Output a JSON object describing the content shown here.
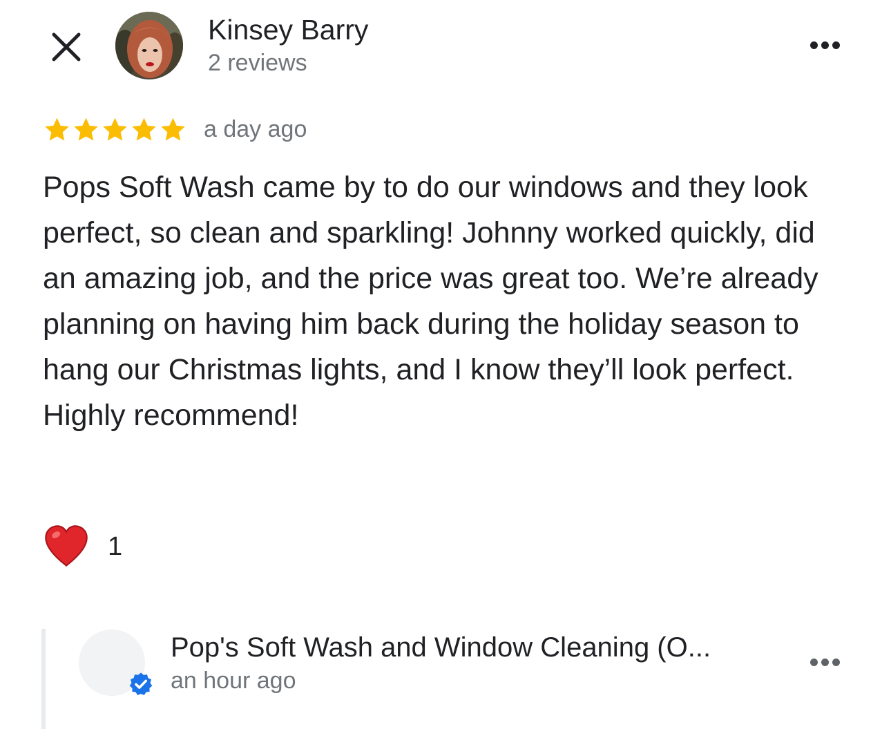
{
  "reviewer": {
    "name": "Kinsey Barry",
    "review_count": "2 reviews"
  },
  "review": {
    "rating": 5,
    "max_rating": 5,
    "date": "a day ago",
    "text": "Pops Soft Wash came by to do our windows and they look perfect, so clean and sparkling! Johnny worked quickly, did an amazing job, and the price was great too. We’re already planning on having him back during the holiday season to hang our Christmas lights, and I know they’ll look perfect. Highly recommend!",
    "reaction_count": "1"
  },
  "owner_reply": {
    "name": "Pop's Soft Wash and Window Cleaning (O...",
    "time": "an hour ago"
  },
  "icons": {
    "close": "close-icon",
    "more": "more-horizontal-icon",
    "star": "star-icon",
    "heart": "heart-icon",
    "verified": "verified-badge-icon"
  },
  "colors": {
    "star": "#fbbc04",
    "heart": "#e0252b",
    "verified": "#1a73e8",
    "secondary_text": "#70757a",
    "primary_text": "#202124"
  }
}
